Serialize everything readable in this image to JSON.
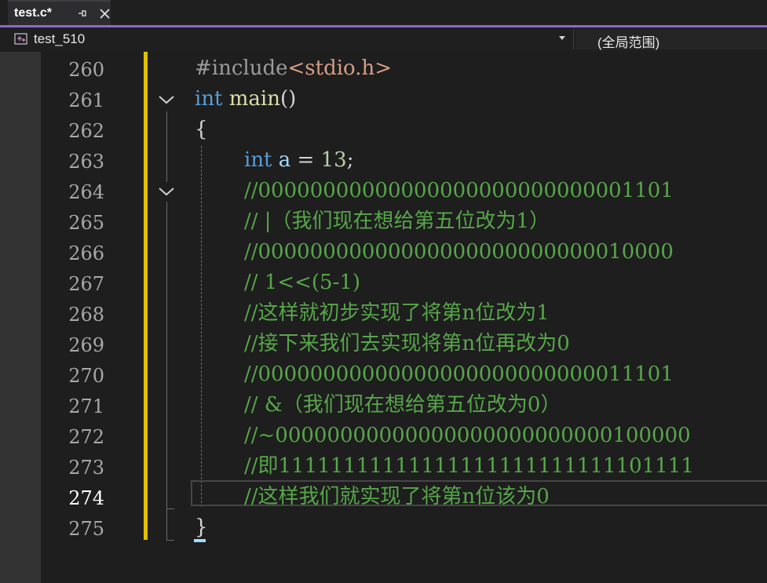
{
  "tab": {
    "title": "test.c*",
    "pin_icon": "pin-icon",
    "close_icon": "close-icon"
  },
  "navbar": {
    "project": "test_510",
    "project_icon": "project-icon",
    "scope": "(全局范围)"
  },
  "colors": {
    "accent": "#8a6ac8",
    "change_bar": "#e3c000",
    "keyword": "#569cd6",
    "comment": "#57a64a",
    "function": "#dcdcaa",
    "string": "#d69d85",
    "variable": "#9cdcfe",
    "number": "#b5cea8"
  },
  "line_numbers": [
    "260",
    "261",
    "262",
    "263",
    "264",
    "265",
    "266",
    "267",
    "268",
    "269",
    "270",
    "271",
    "272",
    "273",
    "274",
    "275"
  ],
  "active_line": "274",
  "code": {
    "l260": {
      "directive": "#include",
      "header": "<stdio.h>"
    },
    "l261": {
      "type": "int",
      "space": " ",
      "func": "main",
      "parens": "()"
    },
    "l262": {
      "brace": "{"
    },
    "l263": {
      "type": "int",
      "space": " ",
      "var": "a",
      "rest": " = ",
      "num": "13",
      "semi": ";"
    },
    "l264": "//00000000000000000000000000001101",
    "l265": "// |（我们现在想给第五位改为1）",
    "l266": "//00000000000000000000000000010000",
    "l267": "// 1<<(5-1)",
    "l268": "//这样就初步实现了将第n位改为1",
    "l269": "//接下来我们去实现将第n位再改为0",
    "l270": "//00000000000000000000000000011101",
    "l271": "// &（我们现在想给第五位改为0）",
    "l272": "//~00000000000000000000000000100000",
    "l273": "//即11111111111111111111111111101111",
    "l274": "//这样我们就实现了将第n位该为0",
    "l275": {
      "brace": "}"
    }
  }
}
